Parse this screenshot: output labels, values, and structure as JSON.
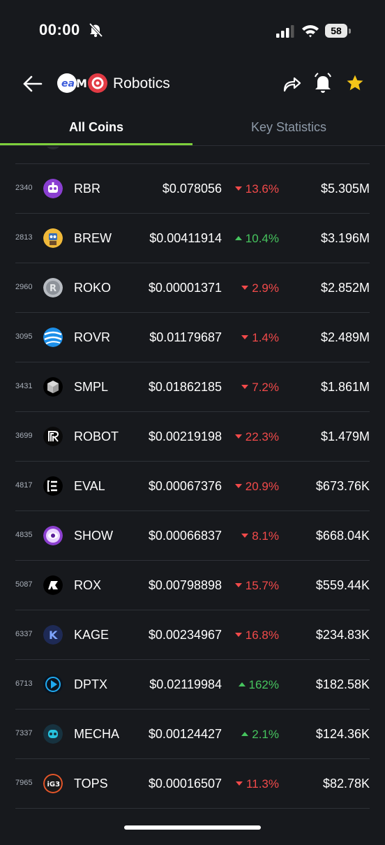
{
  "status_bar": {
    "time": "00:00",
    "battery": "58"
  },
  "header": {
    "title": "Robotics",
    "logo_mark": "M"
  },
  "tabs": [
    {
      "label": "All Coins",
      "active": true
    },
    {
      "label": "Key Statistics",
      "active": false
    }
  ],
  "colors": {
    "accent": "#7ed03c",
    "up": "#46c45e",
    "down": "#f24a4a",
    "star": "#f5c518",
    "background": "#17191d"
  },
  "coins": [
    {
      "rank": "2340",
      "symbol": "RBR",
      "price": "$0.078056",
      "change": "13.6%",
      "direction": "down",
      "mcap": "$5.305M",
      "icon": "robot-face-icon"
    },
    {
      "rank": "2813",
      "symbol": "BREW",
      "price": "$0.00411914",
      "change": "10.4%",
      "direction": "up",
      "mcap": "$3.196M",
      "icon": "brew-robot-icon"
    },
    {
      "rank": "2960",
      "symbol": "ROKO",
      "price": "$0.00001371",
      "change": "2.9%",
      "direction": "down",
      "mcap": "$2.852M",
      "icon": "silver-coin-icon"
    },
    {
      "rank": "3095",
      "symbol": "ROVR",
      "price": "$0.01179687",
      "change": "1.4%",
      "direction": "down",
      "mcap": "$2.489M",
      "icon": "blue-globe-icon"
    },
    {
      "rank": "3431",
      "symbol": "SMPL",
      "price": "$0.01862185",
      "change": "7.2%",
      "direction": "down",
      "mcap": "$1.861M",
      "icon": "cube-icon"
    },
    {
      "rank": "3699",
      "symbol": "ROBOT",
      "price": "$0.00219198",
      "change": "22.3%",
      "direction": "down",
      "mcap": "$1.479M",
      "icon": "stripes-r-icon"
    },
    {
      "rank": "4817",
      "symbol": "EVAL",
      "price": "$0.00067376",
      "change": "20.9%",
      "direction": "down",
      "mcap": "$673.76K",
      "icon": "bracket-e-icon"
    },
    {
      "rank": "4835",
      "symbol": "SHOW",
      "price": "$0.00066837",
      "change": "8.1%",
      "direction": "down",
      "mcap": "$668.04K",
      "icon": "eye-badge-icon"
    },
    {
      "rank": "5087",
      "symbol": "ROX",
      "price": "$0.00798898",
      "change": "15.7%",
      "direction": "down",
      "mcap": "$559.44K",
      "icon": "rox-shape-icon"
    },
    {
      "rank": "6337",
      "symbol": "KAGE",
      "price": "$0.00234967",
      "change": "16.8%",
      "direction": "down",
      "mcap": "$234.83K",
      "icon": "k-letter-icon"
    },
    {
      "rank": "6713",
      "symbol": "DPTX",
      "price": "$0.02119984",
      "change": "162%",
      "direction": "up",
      "mcap": "$182.58K",
      "icon": "play-d-icon"
    },
    {
      "rank": "7337",
      "symbol": "MECHA",
      "price": "$0.00124427",
      "change": "2.1%",
      "direction": "up",
      "mcap": "$124.36K",
      "icon": "mecha-head-icon"
    },
    {
      "rank": "7965",
      "symbol": "TOPS",
      "price": "$0.00016507",
      "change": "11.3%",
      "direction": "down",
      "mcap": "$82.78K",
      "icon": "ig3-ring-icon"
    }
  ]
}
